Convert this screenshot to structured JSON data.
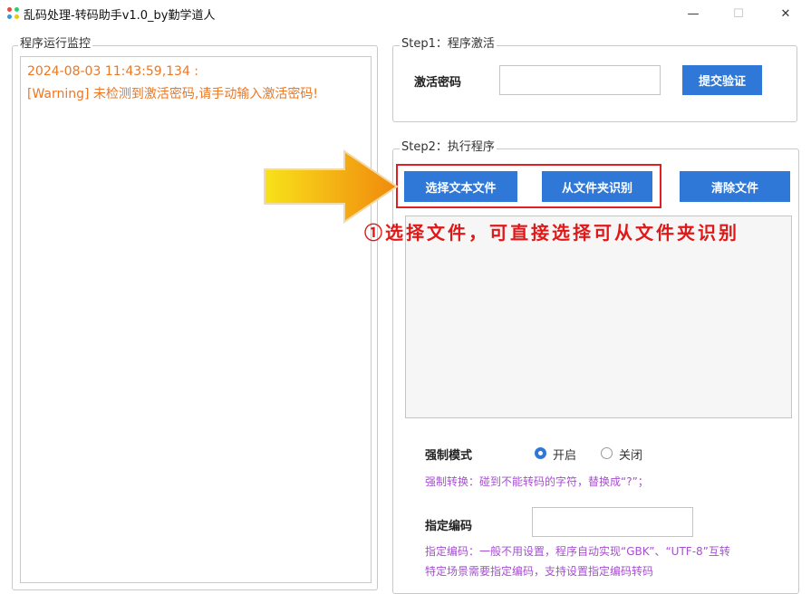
{
  "window": {
    "title": "乱码处理-转码助手v1.0_by勤学道人",
    "minimize": "—",
    "maximize": "☐",
    "close": "✕"
  },
  "monitor": {
    "legend": "程序运行监控",
    "log_lines": [
      "2024-08-03 11:43:59,134 :",
      " [Warning] 未检测到激活密码,请手动输入激活密码!"
    ]
  },
  "step1": {
    "legend": "Step1：程序激活",
    "code_label": "激活密码",
    "code_value": "",
    "submit_label": "提交验证"
  },
  "step2": {
    "legend": "Step2：执行程序",
    "select_file_label": "选择文本文件",
    "from_folder_label": "从文件夹识别",
    "clear_label": "清除文件",
    "force_mode_label": "强制模式",
    "radio_on_label": "开启",
    "radio_off_label": "关闭",
    "force_mode_selected": "开启",
    "force_hint": "强制转换：碰到不能转码的字符，替换成“?”；",
    "encoding_label": "指定编码",
    "encoding_value": "",
    "encoding_hint_1": "指定编码：一般不用设置，程序自动实现“GBK”、“UTF-8”互转",
    "encoding_hint_2": "特定场景需要指定编码，支持设置指定编码转码"
  },
  "annotation": {
    "text": "①选择文件，可直接选择可从文件夹识别",
    "color": "#e01818"
  },
  "colors": {
    "button_blue": "#2f78d8",
    "log_orange": "#ee7722",
    "hint_purple": "#a64fd0",
    "arrow_orange": "#f39c12",
    "highlight_red": "#e02020"
  }
}
